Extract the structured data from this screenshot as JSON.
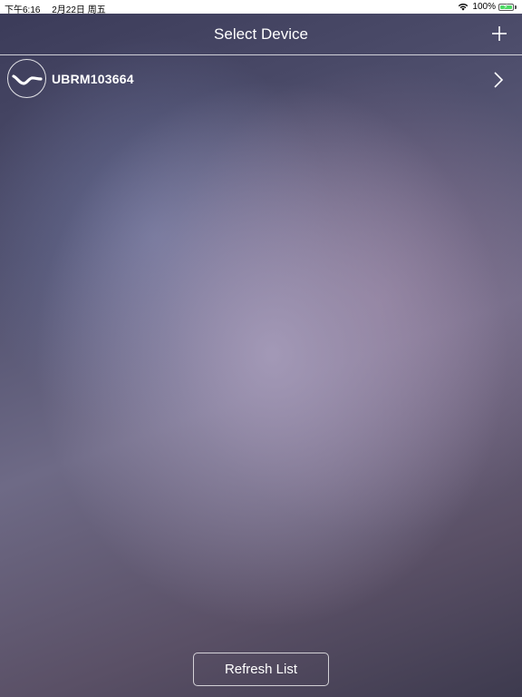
{
  "status_bar": {
    "time": "下午6:16",
    "date": "2月22日 周五",
    "battery_percent": "100%",
    "battery_level": 1.0,
    "wifi_icon": "wifi-icon",
    "battery_icon": "battery-charging-icon"
  },
  "nav": {
    "title": "Select Device",
    "add_icon": "plus-icon"
  },
  "devices": [
    {
      "name": "UBRM103664",
      "icon": "device-wave-icon",
      "chevron_icon": "chevron-right-icon"
    }
  ],
  "refresh_label": "Refresh List",
  "colors": {
    "status_bar_bg": "#ffffff",
    "battery_green": "#4cd964",
    "text": "#ffffff"
  }
}
